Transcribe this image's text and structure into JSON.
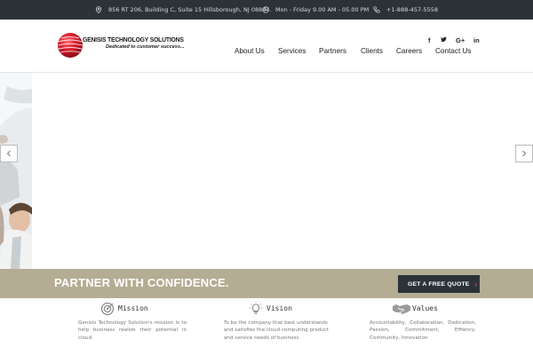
{
  "topbar": {
    "address": "856 RT 206, Building C, Suite 15 Hillsborough, NJ 08844.",
    "hours": "Mon - Friday 9.00 AM - 05.00 PM",
    "phone": "+1-888-457-5558",
    "address_icon": "location-pin-icon",
    "hours_icon": "clock-icon",
    "phone_icon": "phone-icon"
  },
  "logo": {
    "brand": "GENISIS TECHNOLOGY SOLUTIONS",
    "tagline": "Dedicated to customer success..."
  },
  "social": {
    "facebook": "f",
    "twitter": "🐦",
    "googleplus": "G+",
    "linkedin": "in"
  },
  "nav": {
    "items": [
      "About Us",
      "Services",
      "Partners",
      "Clients",
      "Careers",
      "Contact Us"
    ]
  },
  "banner": {
    "title": "PARTNER WITH CONFIDENCE.",
    "button_label": "GET A FREE QUOTE",
    "button_chevron": "›"
  },
  "features": {
    "mission": {
      "title": "Mission",
      "text": "Genisis Technology Solution's mission is to help business realize their potential in cloud."
    },
    "vision": {
      "title": "Vision",
      "text": "To be the company that best understands and satisfies the cloud computing product and service needs of business"
    },
    "values": {
      "title": "Values",
      "text": "Accountability, Collaboration, Dedication, Passion, Commitment, Effiency, Community, Innovation"
    }
  },
  "colors": {
    "topbar": "#2c3338",
    "banner": "#b4ad93",
    "button": "#2c3338",
    "button_chevron": "#e35d3b",
    "logo_red": "#d7182a"
  }
}
